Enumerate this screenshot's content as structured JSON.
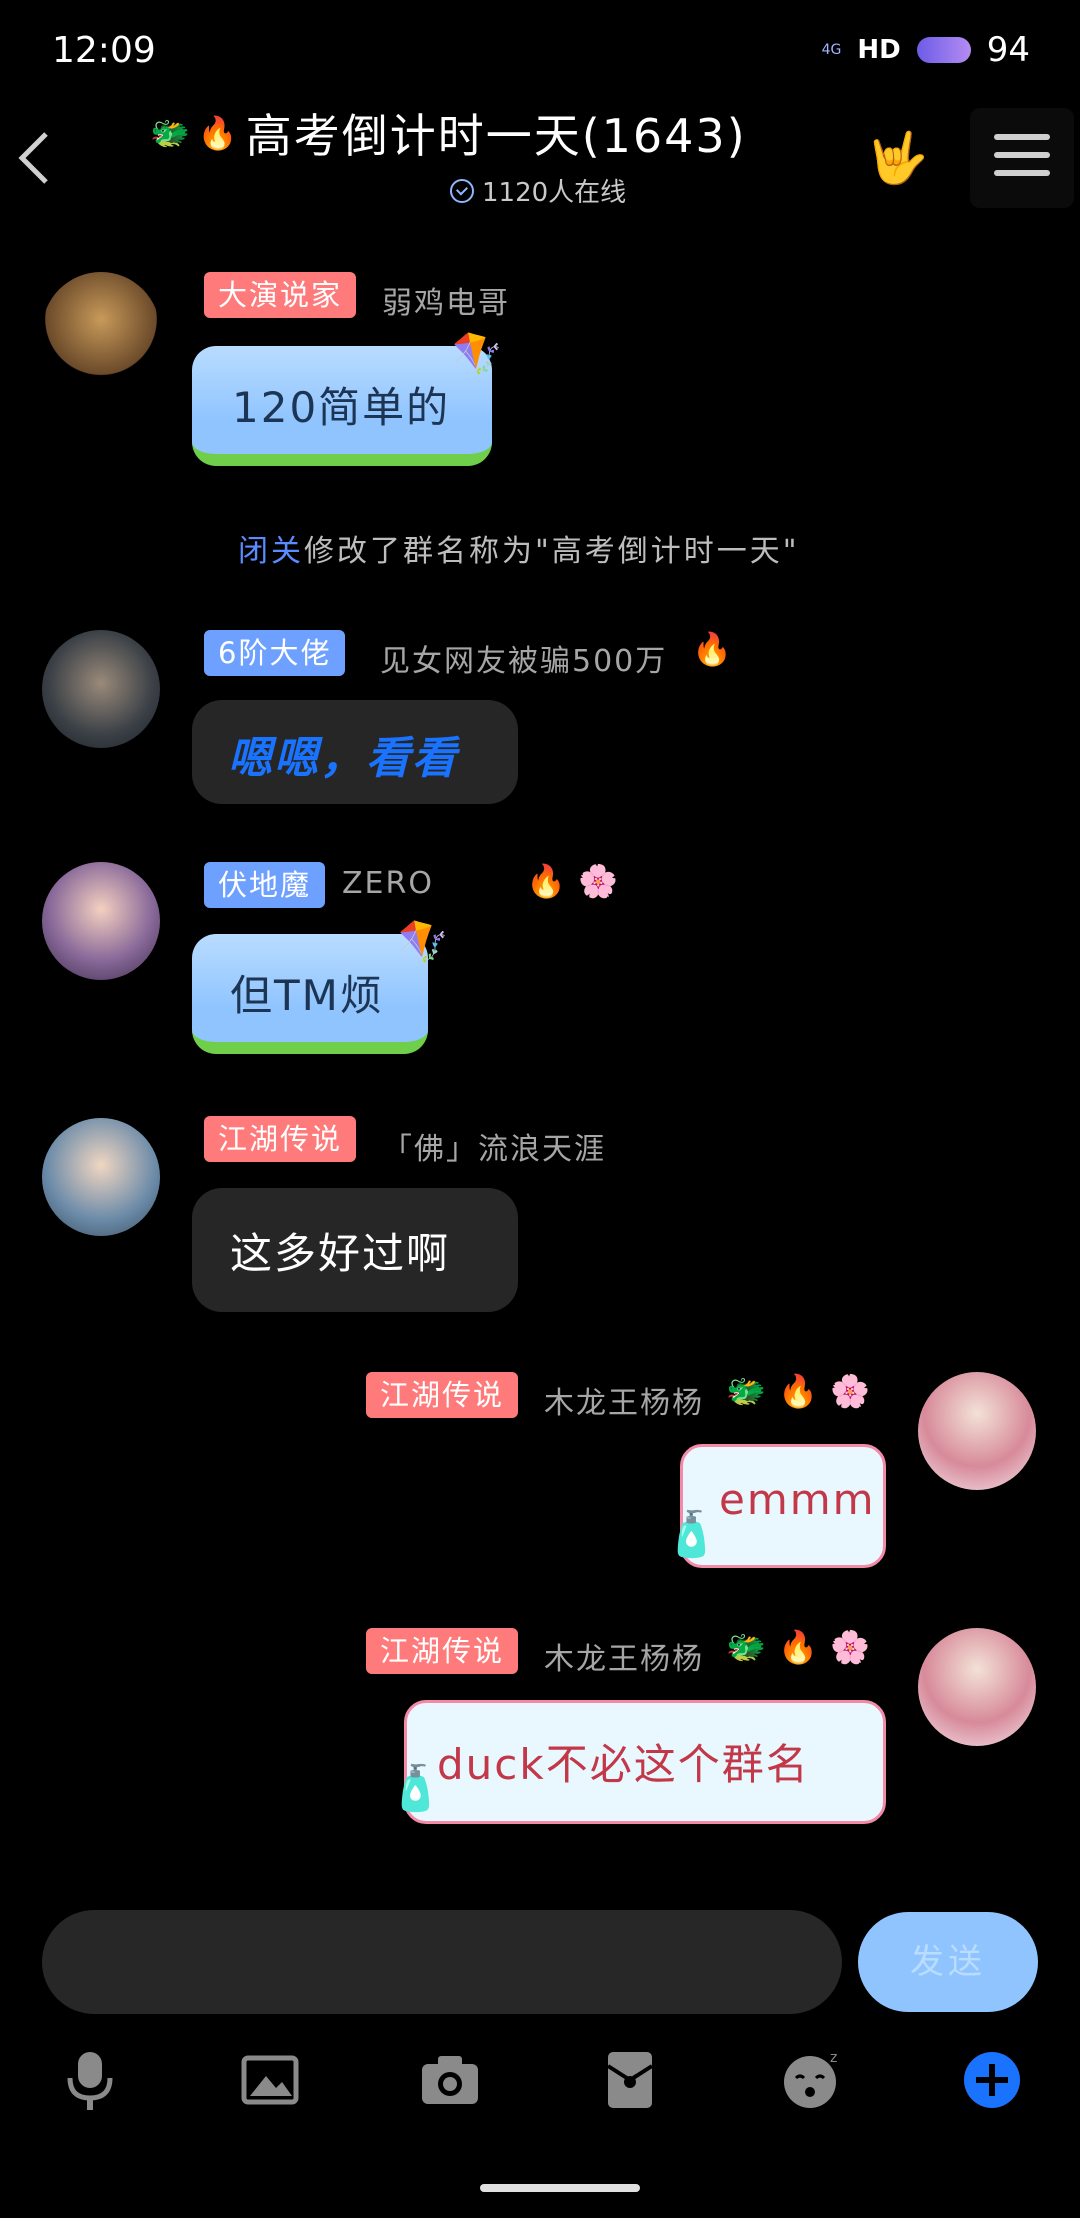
{
  "status_bar": {
    "time": "12:09",
    "network": "4G",
    "hd": "HD",
    "battery": "94"
  },
  "header": {
    "title": "高考倒计时一天(1643)",
    "online": "1120人在线"
  },
  "messages": [
    {
      "side": "left",
      "badge": "大演说家",
      "badge_color": "#ff7a7a",
      "nickname": "弱鸡电哥",
      "text": "120简单的",
      "style": "sky"
    },
    {
      "side": "system",
      "actor": "闭关",
      "text": "修改了群名称为\"高考倒计时一天\""
    },
    {
      "side": "left",
      "badge": "6阶大佬",
      "badge_color": "#6ea1ff",
      "nickname": "见女网友被骗500万",
      "text": "嗯嗯，看看",
      "style": "dark-blue"
    },
    {
      "side": "left",
      "badge": "伏地魔",
      "badge_color": "#6ea1ff",
      "nickname": "ZERO",
      "text": "但TM烦",
      "style": "sky"
    },
    {
      "side": "left",
      "badge": "江湖传说",
      "badge_color": "#ff7a7a",
      "nickname": "「佛」流浪天涯",
      "text": "这多好过啊",
      "style": "dark"
    },
    {
      "side": "right",
      "badge": "江湖传说",
      "badge_color": "#ff7a7a",
      "nickname": "木龙王杨杨",
      "text": "emmm",
      "style": "pink"
    },
    {
      "side": "right",
      "badge": "江湖传说",
      "badge_color": "#ff7a7a",
      "nickname": "木龙王杨杨",
      "text": "duck不必这个群名",
      "style": "pink"
    }
  ],
  "composer": {
    "send_label": "发送"
  },
  "toolbar": [
    "microphone-icon",
    "image-icon",
    "camera-icon",
    "red-packet-icon",
    "sticker-icon",
    "plus-icon"
  ],
  "colors": {
    "accent": "#1a73ff",
    "bubble_sky": "#8fc4ff",
    "badge_red": "#ff7a7a",
    "badge_blue": "#6ea1ff"
  }
}
